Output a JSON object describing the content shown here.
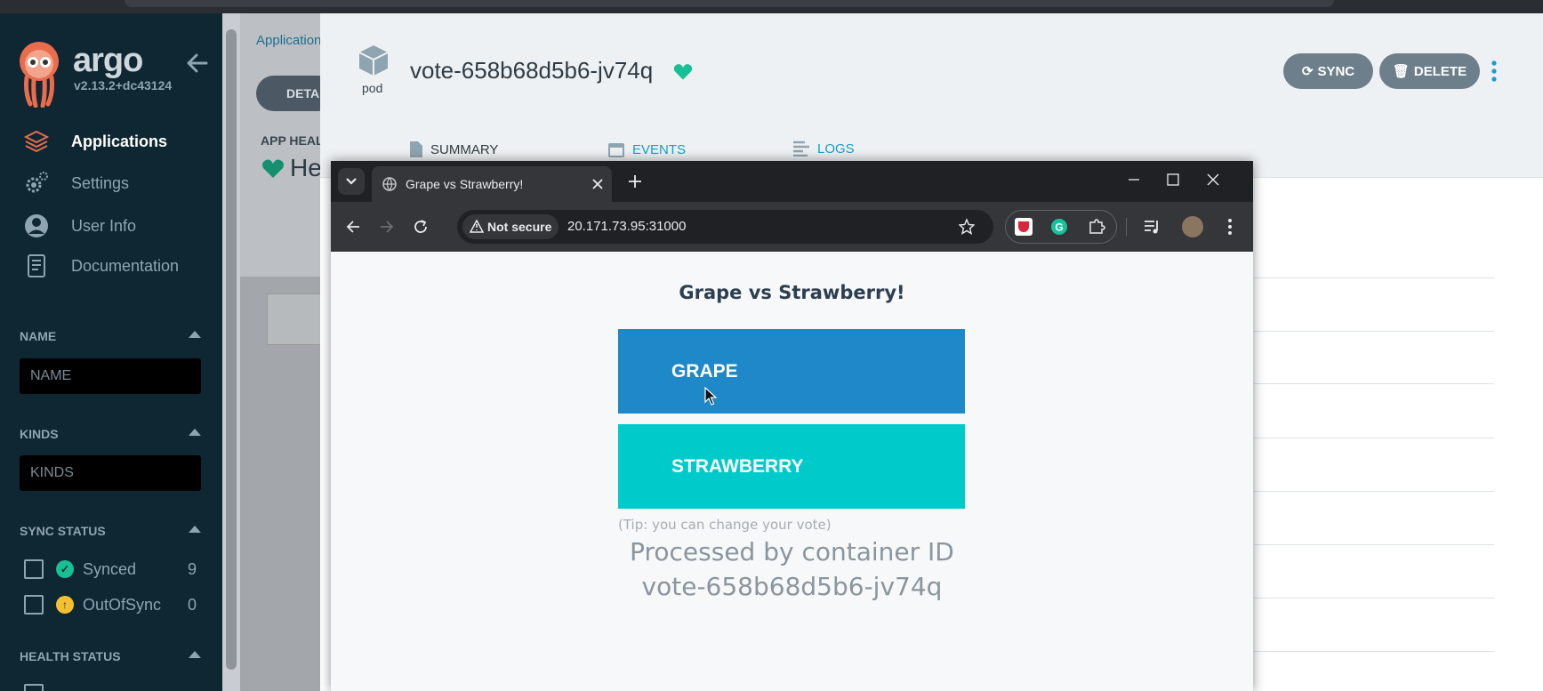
{
  "sidebar": {
    "brand": "argo",
    "version": "v2.13.2+dc43124",
    "nav": [
      {
        "label": "Applications",
        "icon": "layers-icon",
        "active": true
      },
      {
        "label": "Settings",
        "icon": "gears-icon"
      },
      {
        "label": "User Info",
        "icon": "user-circle-icon"
      },
      {
        "label": "Documentation",
        "icon": "book-icon"
      }
    ],
    "filters": {
      "name": {
        "heading": "NAME",
        "placeholder": "NAME"
      },
      "kinds": {
        "heading": "KINDS",
        "placeholder": "KINDS"
      },
      "sync_status": {
        "heading": "SYNC STATUS",
        "items": [
          {
            "label": "Synced",
            "count": "9",
            "color": "#18be94"
          },
          {
            "label": "OutOfSync",
            "count": "0",
            "color": "#f4c030"
          }
        ]
      },
      "health_status": {
        "heading": "HEALTH STATUS"
      }
    }
  },
  "background_app": {
    "breadcrumb": "Applications",
    "details_button": "DETA",
    "app_health_label": "APP HEALTH",
    "health_text": "He"
  },
  "pod_panel": {
    "kind_label": "pod",
    "title": "vote-658b68d5b6-jv74q",
    "sync_button": "SYNC",
    "delete_button": "DELETE",
    "tabs": [
      {
        "label": "SUMMARY",
        "icon": "document-icon"
      },
      {
        "label": "EVENTS",
        "icon": "calendar-icon"
      },
      {
        "label": "LOGS",
        "icon": "logs-icon"
      }
    ]
  },
  "browser": {
    "tab_title": "Grape vs Strawberry!",
    "security_label": "Not secure",
    "url": "20.171.73.95:31000"
  },
  "vote_page": {
    "heading": "Grape vs Strawberry!",
    "option_a": "GRAPE",
    "option_b": "STRAWBERRY",
    "tip": "(Tip: you can change your vote)",
    "processed_line1": "Processed by container ID",
    "processed_line2": "vote-658b68d5b6-jv74q"
  },
  "colors": {
    "argo_sidebar": "#0f2733",
    "grape": "#1e88c9",
    "strawberry": "#00cbca",
    "healthy": "#18be94",
    "accent_link": "#1b9ec5"
  }
}
